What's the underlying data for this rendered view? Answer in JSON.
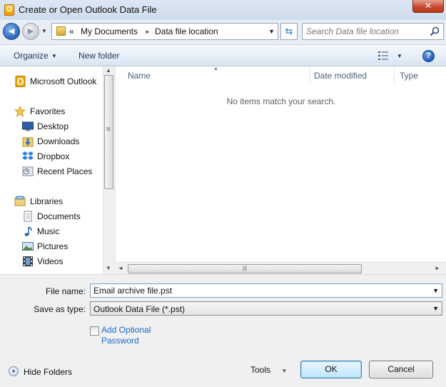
{
  "window": {
    "title": "Create or Open Outlook Data File",
    "close_glyph": "✕"
  },
  "nav": {
    "back_glyph": "◄",
    "forward_glyph": "►",
    "dropdown_glyph": "▼"
  },
  "address": {
    "separator": "«",
    "crumbs": [
      "My Documents",
      "Data file location"
    ],
    "crumb_arrow": "►",
    "dropdown_glyph": "▼",
    "refresh_glyph": "⇆"
  },
  "search": {
    "placeholder": "Search Data file location"
  },
  "commandbar": {
    "organize": "Organize",
    "organize_arrow": "▼",
    "new_folder": "New folder",
    "views_arrow": "▼",
    "help": "?"
  },
  "sidebar": {
    "items": [
      {
        "label": "Microsoft Outlook",
        "icon": "outlook-icon"
      },
      {
        "label": "Favorites",
        "icon": "star-icon"
      },
      {
        "label": "Desktop",
        "icon": "desktop-icon"
      },
      {
        "label": "Downloads",
        "icon": "downloads-icon"
      },
      {
        "label": "Dropbox",
        "icon": "dropbox-icon"
      },
      {
        "label": "Recent Places",
        "icon": "recent-places-icon"
      },
      {
        "label": "Libraries",
        "icon": "libraries-icon"
      },
      {
        "label": "Documents",
        "icon": "documents-icon"
      },
      {
        "label": "Music",
        "icon": "music-icon"
      },
      {
        "label": "Pictures",
        "icon": "pictures-icon"
      },
      {
        "label": "Videos",
        "icon": "videos-icon"
      }
    ]
  },
  "file_list": {
    "columns": [
      "Name",
      "Date modified",
      "Type"
    ],
    "sort_glyph": "▲",
    "empty_message": "No items match your search."
  },
  "scroll": {
    "up": "▲",
    "down": "▼",
    "left": "◄",
    "right": "►",
    "grip_v": "≡",
    "grip_h": "|||"
  },
  "form": {
    "file_name_label": "File name:",
    "file_name_value": "Email archive file.pst",
    "save_type_label": "Save as type:",
    "save_type_value": "Outlook Data File (*.pst)",
    "combo_arrow": "▼",
    "optional_password": "Add Optional Password"
  },
  "footer": {
    "hide_folders": "Hide Folders",
    "hide_glyph": "▲",
    "tools": "Tools",
    "tools_arrow": "▼",
    "ok": "OK",
    "cancel": "Cancel"
  },
  "colors": {
    "accent": "#1a6ac6",
    "titlebar": "#d6e2f0",
    "close": "#c7452a"
  }
}
